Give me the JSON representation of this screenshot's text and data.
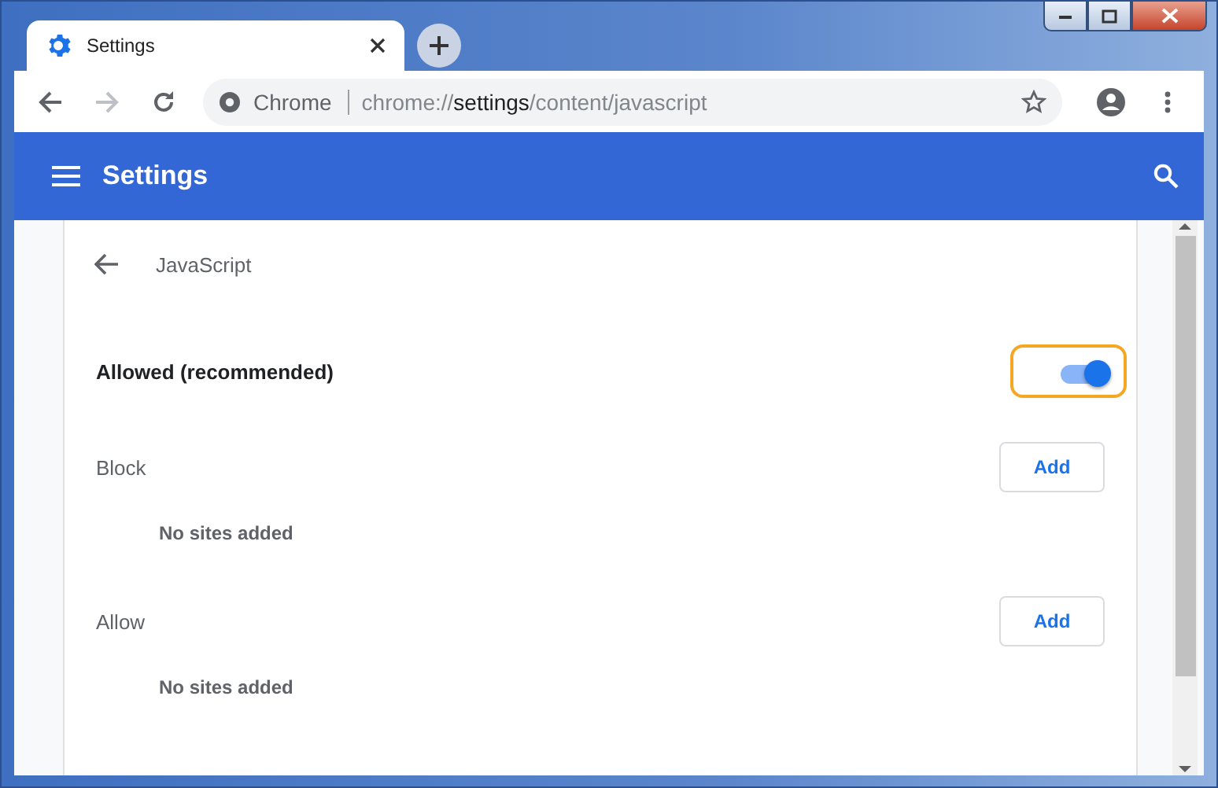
{
  "tabs": [
    {
      "label": "Settings",
      "selected": true
    }
  ],
  "address_bar": {
    "origin_label": "Chrome",
    "url": {
      "scheme": "chrome://",
      "host": "settings",
      "path": "/content/javascript"
    }
  },
  "header": {
    "title": "Settings"
  },
  "page": {
    "title": "JavaScript",
    "main_toggle": {
      "label": "Allowed (recommended)",
      "on": true,
      "focused": true
    },
    "sections": [
      {
        "label": "Block",
        "button": "Add",
        "empty_text": "No sites added"
      },
      {
        "label": "Allow",
        "button": "Add",
        "empty_text": "No sites added"
      }
    ]
  }
}
